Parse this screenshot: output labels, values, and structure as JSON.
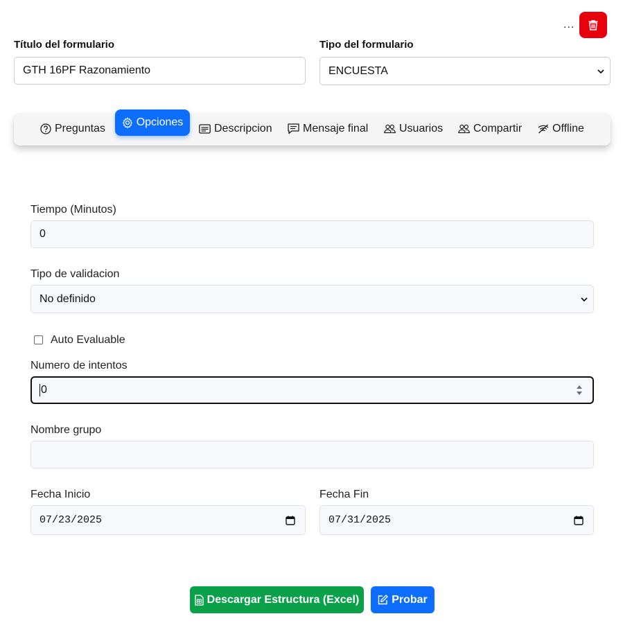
{
  "header": {
    "more_label": "...",
    "delete_icon": "trash-icon",
    "delete_color": "#e8000f"
  },
  "form": {
    "title_label": "Título del formulario",
    "title_value": "GTH 16PF Razonamiento",
    "type_label": "Tipo del formulario",
    "type_value": "ENCUESTA"
  },
  "tabs": [
    {
      "label": "Preguntas",
      "icon": "question-circle-icon",
      "active": false
    },
    {
      "label": "Opciones",
      "icon": "gear-icon",
      "active": true
    },
    {
      "label": "Descripcion",
      "icon": "card-text-icon",
      "active": false
    },
    {
      "label": "Mensaje final",
      "icon": "chat-text-icon",
      "active": false
    },
    {
      "label": "Usuarios",
      "icon": "people-icon",
      "active": false
    },
    {
      "label": "Compartir",
      "icon": "people-icon",
      "active": false
    },
    {
      "label": "Offline",
      "icon": "wifi-off-icon",
      "active": false
    }
  ],
  "options": {
    "time_label": "Tiempo (Minutos)",
    "time_value": "0",
    "validation_label": "Tipo de validacion",
    "validation_value": "No definido",
    "auto_eval_label": "Auto Evaluable",
    "auto_eval_checked": false,
    "attempts_label": "Numero de intentos",
    "attempts_value": "0",
    "group_label": "Nombre grupo",
    "group_value": "",
    "start_label": "Fecha Inicio",
    "start_value": "07/23/2025",
    "end_label": "Fecha Fin",
    "end_value": "07/31/2025"
  },
  "actions": {
    "download_label": "Descargar Estructura (Excel)",
    "download_icon": "file-excel-icon",
    "download_color": "#0ba04a",
    "test_label": "Probar",
    "test_icon": "pencil-square-icon",
    "test_color": "#0d6efd"
  },
  "colors": {
    "accent": "#0d6efd"
  }
}
